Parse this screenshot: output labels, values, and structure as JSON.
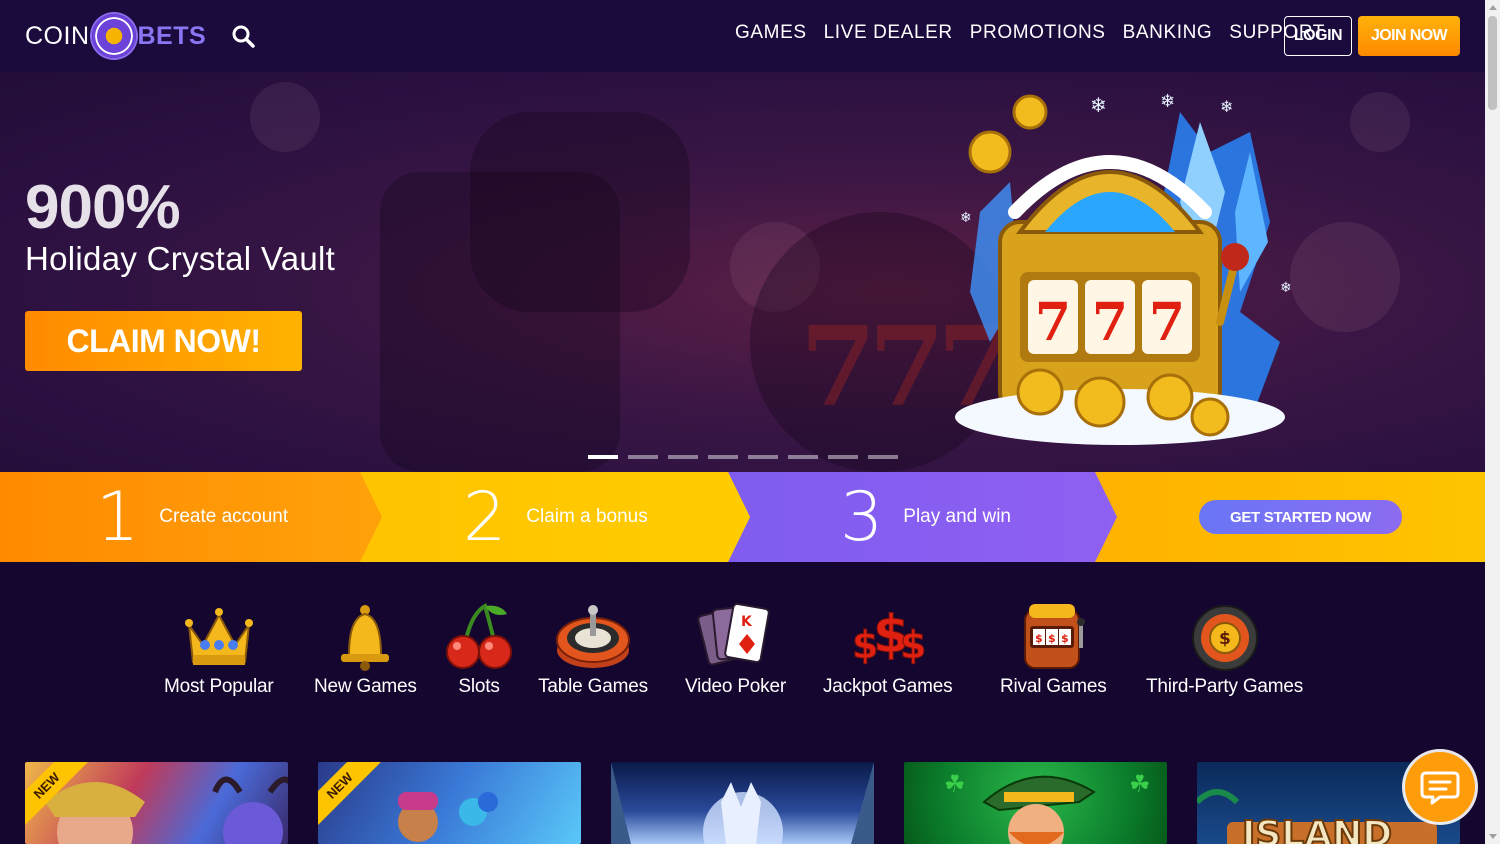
{
  "header": {
    "logo_left": "COIN",
    "logo_right": "BETS",
    "nav": [
      "GAMES",
      "LIVE DEALER",
      "PROMOTIONS",
      "BANKING",
      "SUPPORT"
    ],
    "login": "LOGIN",
    "join": "JOIN NOW"
  },
  "hero": {
    "percent": "900%",
    "title": "Holiday Crystal Vault",
    "cta": "CLAIM NOW!",
    "slides": 8,
    "active_slide": 1
  },
  "steps": {
    "items": [
      {
        "num": "1",
        "label": "Create account"
      },
      {
        "num": "2",
        "label": "Claim a bonus"
      },
      {
        "num": "3",
        "label": "Play and win"
      }
    ],
    "cta": "GET STARTED NOW"
  },
  "categories": [
    {
      "label": "Most Popular",
      "icon": "crown-icon"
    },
    {
      "label": "New Games",
      "icon": "bell-icon"
    },
    {
      "label": "Slots",
      "icon": "cherries-icon"
    },
    {
      "label": "Table Games",
      "icon": "roulette-icon"
    },
    {
      "label": "Video Poker",
      "icon": "cards-icon"
    },
    {
      "label": "Jackpot Games",
      "icon": "dollar-signs-icon"
    },
    {
      "label": "Rival Games",
      "icon": "slot-machine-icon"
    },
    {
      "label": "Third-Party Games",
      "icon": "chip-icon"
    }
  ],
  "games": [
    {
      "badge": "NEW"
    },
    {
      "badge": "NEW"
    },
    {
      "badge": ""
    },
    {
      "badge": ""
    },
    {
      "badge": ""
    }
  ],
  "colors": {
    "header_bg": "#1b0b3d",
    "accent_orange": "#ff9c0a",
    "accent_purple": "#8b5cf6",
    "step_yellow": "#ffc400"
  }
}
